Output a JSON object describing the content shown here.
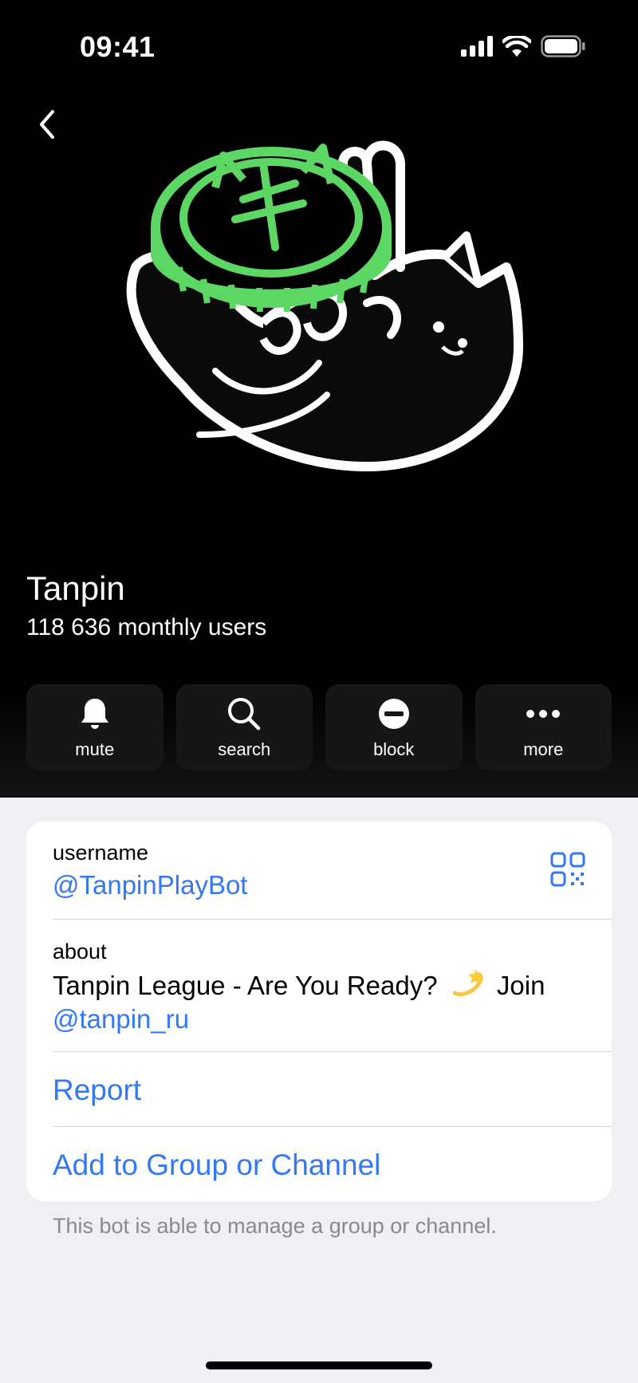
{
  "status_bar": {
    "time": "09:41"
  },
  "profile": {
    "name": "Tanpin",
    "subtitle": "118 636 monthly users"
  },
  "actions": [
    {
      "label": "mute",
      "icon": "bell-icon"
    },
    {
      "label": "search",
      "icon": "search-icon"
    },
    {
      "label": "block",
      "icon": "block-icon"
    },
    {
      "label": "more",
      "icon": "more-icon"
    }
  ],
  "info": {
    "username_label": "username",
    "username_value": "@TanpinPlayBot",
    "about_label": "about",
    "about_text": "Tanpin League - Are You Ready?",
    "about_emoji": "dizzy-emoji",
    "about_join": "Join",
    "about_link": "@tanpin_ru",
    "report_label": "Report",
    "add_label": "Add to Group or Channel"
  },
  "footer_note": "This bot is able to manage a group or channel.",
  "colors": {
    "accent": "#3478f6",
    "avatar_green": "#5dd764",
    "hero_bg": "#000000",
    "page_bg": "#efeff4"
  }
}
